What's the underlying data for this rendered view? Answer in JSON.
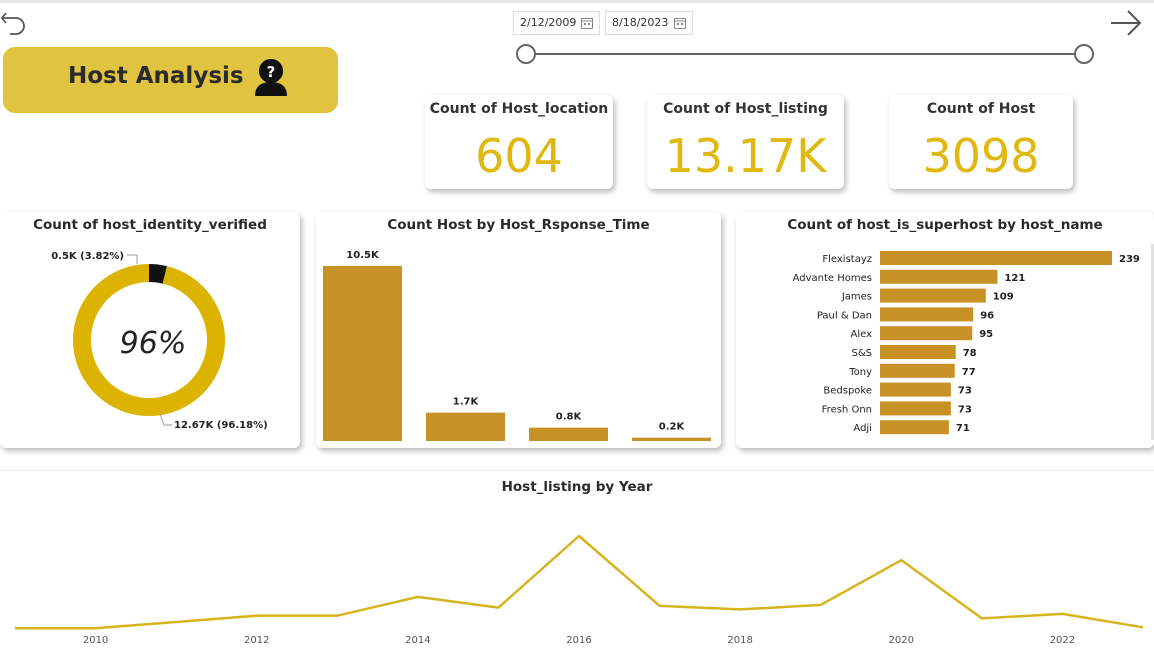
{
  "header": {
    "title": "Host Analysis",
    "date_start": "2/12/2009",
    "date_end": "8/18/2023"
  },
  "kpis": [
    {
      "label": "Count of Host_location",
      "value": "604"
    },
    {
      "label": "Count of Host_listing",
      "value": "13.17K"
    },
    {
      "label": "Count of Host",
      "value": "3098"
    }
  ],
  "icons": {
    "back": "undo-arrow-icon",
    "next": "right-arrow-icon",
    "help": "user-question-icon",
    "calendar": "calendar-icon"
  },
  "colors": {
    "accent": "#e0c43f",
    "kpi_value": "#e0b810",
    "bar": "#c79126",
    "donut": "#dcb400",
    "line": "#d6b41e"
  },
  "donut": {
    "title": "Count of host_identity_verified",
    "center_label": "96%",
    "label_small": "0.5K (3.82%)",
    "label_large": "12.67K (96.18%)"
  },
  "chart_data": [
    {
      "type": "pie",
      "title": "Count of host_identity_verified",
      "slices": [
        {
          "value": 0.5,
          "percent": 3.82,
          "label": "0.5K (3.82%)",
          "color": "#111111"
        },
        {
          "value": 12.67,
          "percent": 96.18,
          "label": "12.67K (96.18%)",
          "color": "#dcb400"
        }
      ]
    },
    {
      "type": "bar",
      "title": "Count Host by Host_Rsponse_Time",
      "values": [
        10.5,
        1.7,
        0.8,
        0.2
      ],
      "labels": [
        "10.5K",
        "1.7K",
        "0.8K",
        "0.2K"
      ],
      "ylim": [
        0,
        10.5
      ]
    },
    {
      "type": "bar",
      "orientation": "horizontal",
      "title": "Count of host_is_superhost by host_name",
      "categories": [
        "Flexistayz",
        "Advante Homes",
        "James",
        "Paul & Dan",
        "Alex",
        "S&S",
        "Tony",
        "Bedspoke",
        "Fresh Onn",
        "Adji"
      ],
      "values": [
        239,
        121,
        109,
        96,
        95,
        78,
        77,
        73,
        73,
        71
      ],
      "xlim": [
        0,
        239
      ]
    },
    {
      "type": "line",
      "title": "Host_listing by Year",
      "x": [
        2009,
        2010,
        2011,
        2012,
        2013,
        2014,
        2015,
        2016,
        2017,
        2018,
        2019,
        2020,
        2021,
        2022,
        2023
      ],
      "y": [
        2,
        2,
        9,
        16,
        16,
        37,
        25,
        105,
        27,
        23,
        28,
        78,
        13,
        18,
        3
      ],
      "x_ticks": [
        "2010",
        "2012",
        "2014",
        "2016",
        "2018",
        "2020",
        "2022"
      ],
      "ylim": [
        0,
        105
      ]
    }
  ]
}
